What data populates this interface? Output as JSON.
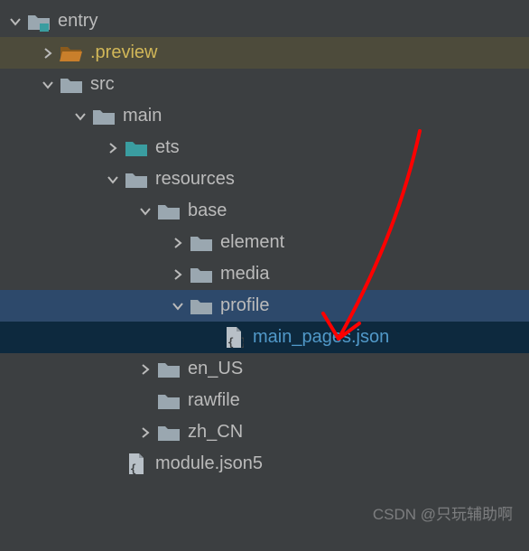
{
  "colors": {
    "bg": "#3c3f41",
    "text": "#bbbbbb",
    "preview_bg": "#4d4b3b",
    "preview_text": "#d1b758",
    "profile_row_bg": "#2d496b",
    "selected_bg": "#0d293e",
    "selected_text": "#5199c9",
    "folder_gray": "#9aa7b0",
    "folder_teal": "#3a9da0",
    "folder_orange": "#c97f2b",
    "annotation_red": "#ff0000"
  },
  "icons": {
    "module_folder": "module-folder",
    "folder_orange": "folder-open-orange",
    "folder_gray": "folder-gray",
    "folder_teal": "folder-teal",
    "json_file": "json-file-icon"
  },
  "tree": {
    "root": {
      "name": "entry",
      "icon": "module-folder",
      "expanded": true,
      "children": [
        {
          "name": ".preview",
          "icon": "folder-open-orange",
          "expanded": false,
          "highlight": "preview"
        },
        {
          "name": "src",
          "icon": "folder-gray",
          "expanded": true,
          "children": [
            {
              "name": "main",
              "icon": "folder-gray",
              "expanded": true,
              "children": [
                {
                  "name": "ets",
                  "icon": "folder-teal",
                  "expanded": false
                },
                {
                  "name": "resources",
                  "icon": "folder-gray",
                  "expanded": true,
                  "children": [
                    {
                      "name": "base",
                      "icon": "folder-gray",
                      "expanded": true,
                      "children": [
                        {
                          "name": "element",
                          "icon": "folder-gray",
                          "expanded": false
                        },
                        {
                          "name": "media",
                          "icon": "folder-gray",
                          "expanded": false
                        },
                        {
                          "name": "profile",
                          "icon": "folder-gray",
                          "expanded": true,
                          "highlight": "profile",
                          "children": [
                            {
                              "name": "main_pages.json",
                              "icon": "json-file-icon",
                              "type": "file",
                              "highlight": "selected"
                            }
                          ]
                        }
                      ]
                    },
                    {
                      "name": "en_US",
                      "icon": "folder-gray",
                      "expanded": false
                    },
                    {
                      "name": "rawfile",
                      "icon": "folder-gray",
                      "expanded": null
                    },
                    {
                      "name": "zh_CN",
                      "icon": "folder-gray",
                      "expanded": false
                    }
                  ]
                },
                {
                  "name": "module.json5",
                  "icon": "json-file-icon",
                  "type": "file"
                }
              ]
            }
          ]
        }
      ]
    }
  },
  "watermark": "CSDN @只玩辅助啊",
  "annotation": {
    "target": "main_pages.json",
    "style": "hand-drawn-red-arrow"
  }
}
